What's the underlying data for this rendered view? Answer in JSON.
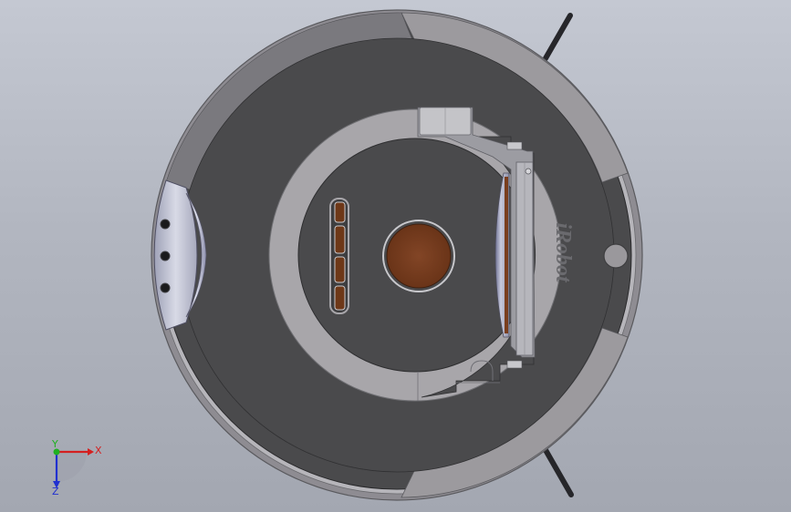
{
  "model": {
    "brand_text": "iRobot"
  },
  "triad": {
    "x_label": "X",
    "y_label": "Y",
    "z_label": "Z",
    "x_color": "#d42020",
    "y_color": "#20b020",
    "z_color": "#2030d0"
  },
  "colors": {
    "shell_dark": "#4a4a4c",
    "ring_light": "#a8a6aa",
    "rim": "#8e8c92",
    "wheel_brown": "#7a3e1e",
    "bumper": "#b4b6c8"
  }
}
